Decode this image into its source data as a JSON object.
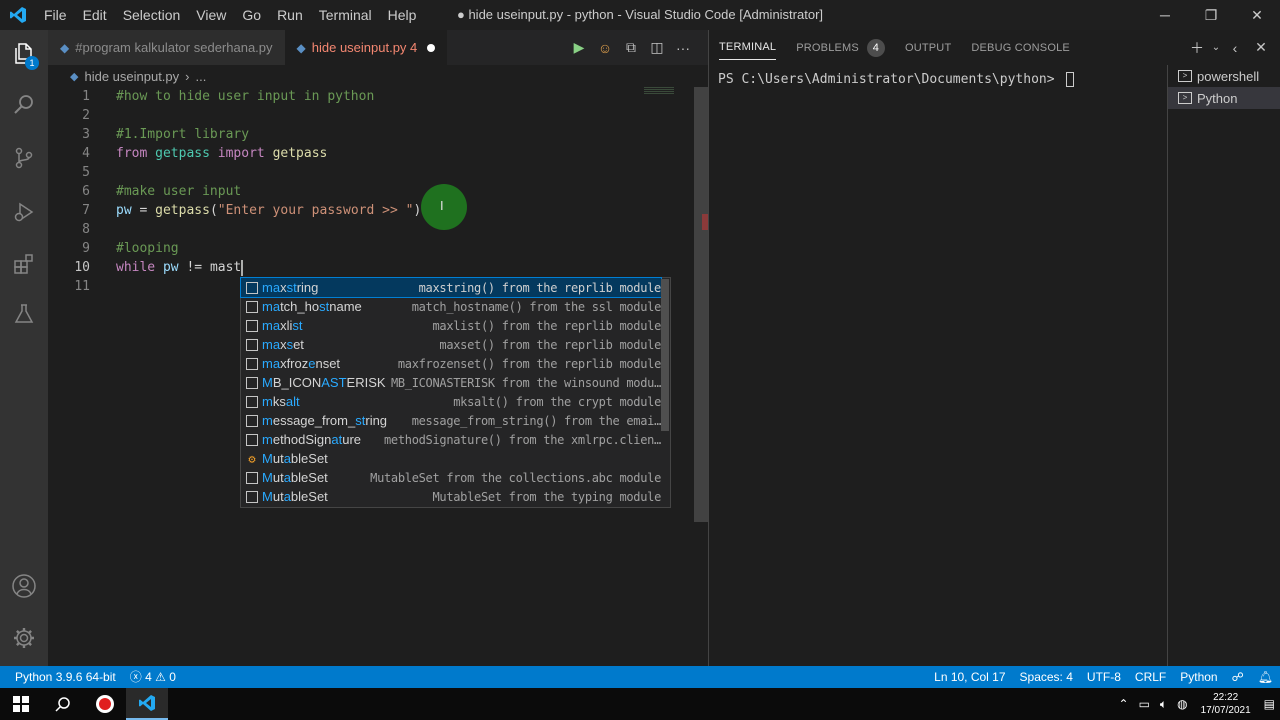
{
  "titlebar": {
    "menu": [
      "File",
      "Edit",
      "Selection",
      "View",
      "Go",
      "Run",
      "Terminal",
      "Help"
    ],
    "title": "● hide useinput.py - python - Visual Studio Code [Administrator]"
  },
  "activity": {
    "explorer_badge": "1"
  },
  "tabs": [
    {
      "label": "#program kalkulator sederhana.py"
    },
    {
      "label": "hide useinput.py 4"
    }
  ],
  "breadcrumb": {
    "file": "hide useinput.py",
    "sep": "›",
    "rest": "..."
  },
  "code": {
    "line_numbers": [
      "1",
      "2",
      "3",
      "4",
      "5",
      "6",
      "7",
      "8",
      "9",
      "10",
      "11"
    ],
    "l1": "#how to hide user input in python",
    "l3": "#1.Import library",
    "l4_from": "from",
    "l4_mod": "getpass",
    "l4_import": "import",
    "l4_name": "getpass",
    "l6": "#make user input",
    "l7_var": "pw",
    "l7_eq": " = ",
    "l7_fn": "getpass",
    "l7_open": "(",
    "l7_str": "\"Enter your password >> \"",
    "l7_close": ")",
    "l9": "#looping",
    "l10_kw": "while",
    "l10_var": "pw",
    "l10_op": " != ",
    "l10_typed": "mast"
  },
  "suggestions": [
    {
      "hl": "ma",
      "mid": "x",
      "hl2": "st",
      "rest": "ring",
      "detail": "maxstring() from the reprlib module",
      "icon": "box",
      "selected": true
    },
    {
      "hl": "ma",
      "mid": "tch_ho",
      "hl2": "st",
      "rest": "name",
      "detail": "match_hostname() from the ssl module",
      "icon": "box"
    },
    {
      "hl": "ma",
      "mid": "xli",
      "hl2": "st",
      "rest": "",
      "detail": "maxlist() from the reprlib module",
      "icon": "box"
    },
    {
      "hl": "ma",
      "mid": "x",
      "hl2": "s",
      "rest": "et",
      "detail": "maxset() from the reprlib module",
      "icon": "box"
    },
    {
      "hl": "ma",
      "mid": "xfroz",
      "hl2": "e",
      "rest": "nset",
      "detail": "maxfrozenset() from the reprlib module",
      "icon": "box"
    },
    {
      "hl": "M",
      "mid": "B_ICON",
      "hl2": "AST",
      "rest": "ERISK",
      "detail": "MB_ICONASTERISK from the winsound modu…",
      "icon": "box"
    },
    {
      "hl": "m",
      "mid": "ks",
      "hl2": "alt",
      "rest": "",
      "detail": "mksalt() from the crypt module",
      "icon": "box"
    },
    {
      "hl": "m",
      "mid": "essage_from_",
      "hl2": "st",
      "rest": "ring",
      "detail": "message_from_string() from the emai…",
      "icon": "box"
    },
    {
      "hl": "m",
      "mid": "ethodSign",
      "hl2": "at",
      "rest": "ure",
      "detail": "methodSignature() from the xmlrpc.clien…",
      "icon": "box"
    },
    {
      "hl": "M",
      "mid": "ut",
      "hl2": "a",
      "rest": "bleSet",
      "detail": "",
      "icon": "class"
    },
    {
      "hl": "M",
      "mid": "ut",
      "hl2": "a",
      "rest": "bleSet",
      "detail": "MutableSet from the collections.abc module",
      "icon": "box"
    },
    {
      "hl": "M",
      "mid": "ut",
      "hl2": "a",
      "rest": "bleSet",
      "detail": "MutableSet from the typing module",
      "icon": "box"
    }
  ],
  "panel": {
    "tabs": [
      "TERMINAL",
      "PROBLEMS",
      "OUTPUT",
      "DEBUG CONSOLE"
    ],
    "problems_count": "4",
    "prompt": "PS C:\\Users\\Administrator\\Documents\\python> ",
    "terminals": [
      "powershell",
      "Python"
    ]
  },
  "status": {
    "interpreter": "Python 3.9.6 64-bit",
    "errors": "4",
    "warnings": "0",
    "position": "Ln 10, Col 17",
    "spaces": "Spaces: 4",
    "encoding": "UTF-8",
    "eol": "CRLF",
    "language": "Python"
  },
  "taskbar": {
    "time": "22:22",
    "date": "17/07/2021"
  },
  "colors": {
    "accent": "#007acc",
    "error": "#f48771",
    "comment": "#6a9955",
    "keyword": "#c586c0",
    "function": "#dcdcaa",
    "string": "#ce9178",
    "variable": "#9cdcfe",
    "match": "#2aaaff"
  }
}
